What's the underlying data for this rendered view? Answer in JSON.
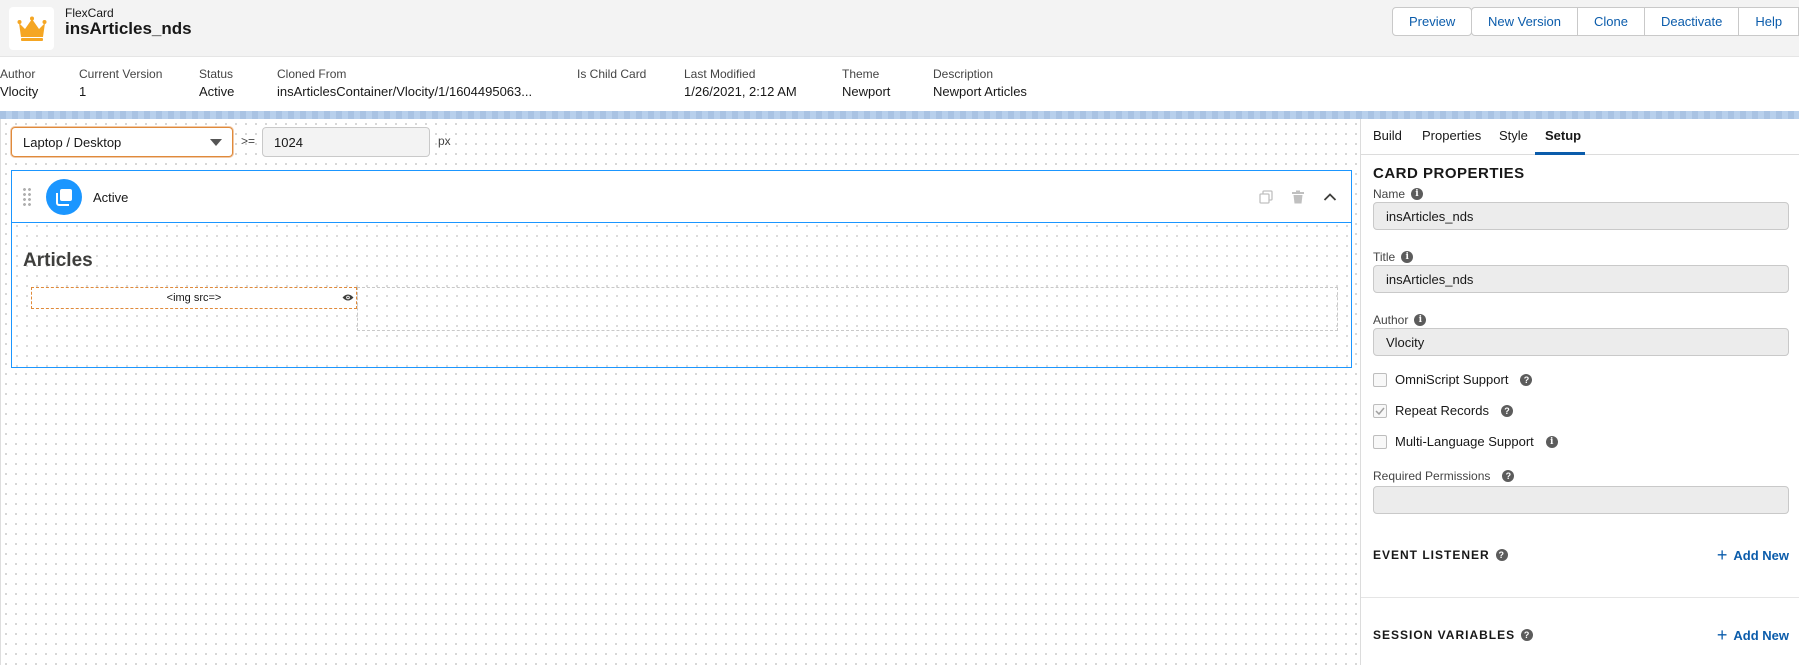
{
  "header": {
    "object_type": "FlexCard",
    "record_name": "insArticles_nds",
    "buttons": {
      "preview": "Preview",
      "new_version": "New Version",
      "clone": "Clone",
      "deactivate": "Deactivate",
      "help": "Help"
    }
  },
  "highlights": [
    {
      "label": "Author",
      "value": "Vlocity"
    },
    {
      "label": "Current Version",
      "value": "1"
    },
    {
      "label": "Status",
      "value": "Active"
    },
    {
      "label": "Cloned From",
      "value": "insArticlesContainer/Vlocity/1/1604495063..."
    },
    {
      "label": "Is Child Card",
      "value": ""
    },
    {
      "label": "Last Modified",
      "value": "1/26/2021, 2:12 AM"
    },
    {
      "label": "Theme",
      "value": "Newport"
    },
    {
      "label": "Description",
      "value": "Newport Articles"
    }
  ],
  "canvas": {
    "device": "Laptop / Desktop",
    "operator": ">=",
    "width_value": "1024",
    "unit": "px",
    "state_label": "Active",
    "card_title": "Articles",
    "image_element_text": "<img src=>"
  },
  "panel": {
    "tabs": [
      "Build",
      "Properties",
      "Style",
      "Setup"
    ],
    "active_tab": "Setup",
    "section_title": "CARD PROPERTIES",
    "name_label": "Name",
    "name_value": "insArticles_nds",
    "title_label": "Title",
    "title_value": "insArticles_nds",
    "author_label": "Author",
    "author_value": "Vlocity",
    "omniscript_support": "OmniScript Support",
    "repeat_records": "Repeat Records",
    "multi_language_support": "Multi-Language Support",
    "required_permissions_label": "Required Permissions",
    "required_permissions_value": "",
    "event_listener_title": "EVENT LISTENER",
    "session_variables_title": "SESSION VARIABLES",
    "add_new_label": "Add New"
  },
  "colors": {
    "brand_blue": "#1b96ff",
    "link_blue": "#0b5cab",
    "focus_orange": "#e08a3a",
    "crown_orange": "#f5a623"
  }
}
